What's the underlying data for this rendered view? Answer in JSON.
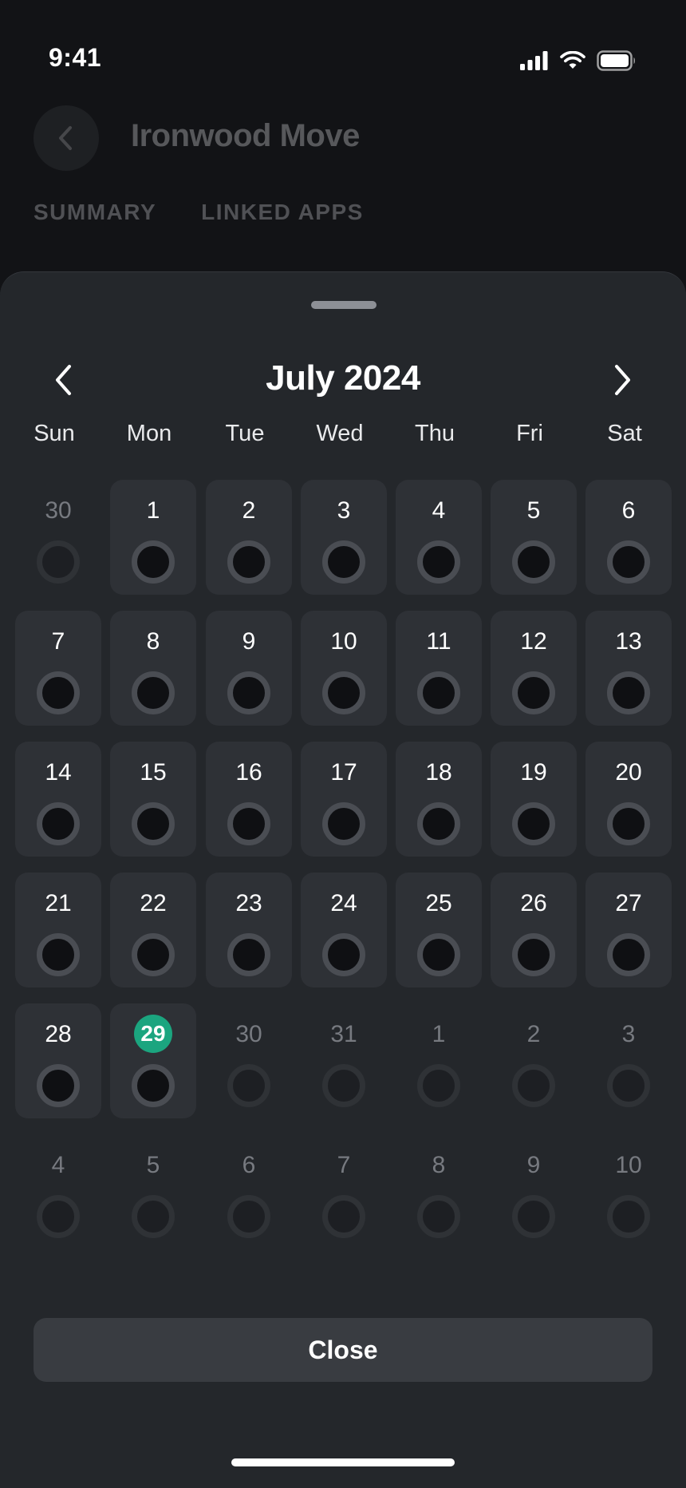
{
  "status_bar": {
    "time": "9:41",
    "icons": [
      "signal-icon",
      "wifi-icon",
      "battery-icon"
    ]
  },
  "background_screen": {
    "title": "Ironwood Move",
    "tabs": [
      "SUMMARY",
      "LINKED APPS"
    ]
  },
  "calendar": {
    "month_label": "July 2024",
    "weekdays": [
      "Sun",
      "Mon",
      "Tue",
      "Wed",
      "Thu",
      "Fri",
      "Sat"
    ],
    "weeks": [
      [
        {
          "day": "30",
          "in_month": false
        },
        {
          "day": "1",
          "in_month": true
        },
        {
          "day": "2",
          "in_month": true
        },
        {
          "day": "3",
          "in_month": true
        },
        {
          "day": "4",
          "in_month": true
        },
        {
          "day": "5",
          "in_month": true
        },
        {
          "day": "6",
          "in_month": true
        }
      ],
      [
        {
          "day": "7",
          "in_month": true
        },
        {
          "day": "8",
          "in_month": true
        },
        {
          "day": "9",
          "in_month": true
        },
        {
          "day": "10",
          "in_month": true
        },
        {
          "day": "11",
          "in_month": true
        },
        {
          "day": "12",
          "in_month": true
        },
        {
          "day": "13",
          "in_month": true
        }
      ],
      [
        {
          "day": "14",
          "in_month": true
        },
        {
          "day": "15",
          "in_month": true
        },
        {
          "day": "16",
          "in_month": true
        },
        {
          "day": "17",
          "in_month": true
        },
        {
          "day": "18",
          "in_month": true
        },
        {
          "day": "19",
          "in_month": true
        },
        {
          "day": "20",
          "in_month": true
        }
      ],
      [
        {
          "day": "21",
          "in_month": true
        },
        {
          "day": "22",
          "in_month": true
        },
        {
          "day": "23",
          "in_month": true
        },
        {
          "day": "24",
          "in_month": true
        },
        {
          "day": "25",
          "in_month": true
        },
        {
          "day": "26",
          "in_month": true
        },
        {
          "day": "27",
          "in_month": true
        }
      ],
      [
        {
          "day": "28",
          "in_month": true
        },
        {
          "day": "29",
          "in_month": true,
          "today": true
        },
        {
          "day": "30",
          "in_month": false
        },
        {
          "day": "31",
          "in_month": false
        },
        {
          "day": "1",
          "in_month": false
        },
        {
          "day": "2",
          "in_month": false
        },
        {
          "day": "3",
          "in_month": false
        }
      ],
      [
        {
          "day": "4",
          "in_month": false
        },
        {
          "day": "5",
          "in_month": false
        },
        {
          "day": "6",
          "in_month": false
        },
        {
          "day": "7",
          "in_month": false
        },
        {
          "day": "8",
          "in_month": false
        },
        {
          "day": "9",
          "in_month": false
        },
        {
          "day": "10",
          "in_month": false
        }
      ]
    ]
  },
  "close_label": "Close",
  "colors": {
    "today_accent": "#1ba57f",
    "sheet_bg": "#24272b",
    "cell_bg": "#2e3136"
  }
}
